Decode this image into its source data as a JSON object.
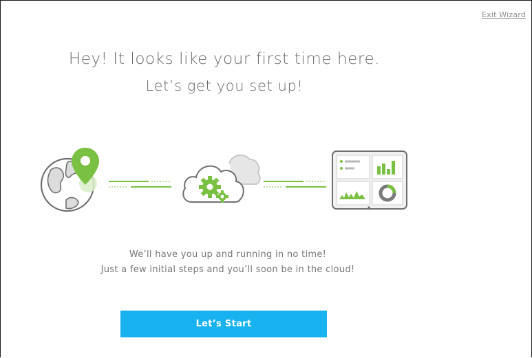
{
  "header": {
    "exit_label": "Exit Wizard"
  },
  "welcome": {
    "line1": "Hey! It looks like your first time here.",
    "line2": "Let’s get you set up!"
  },
  "illustration": {
    "icons": [
      "globe-location-icon",
      "cloud-gear-icon",
      "dashboard-icon"
    ]
  },
  "description": {
    "line1": "We’ll have you up and running in no time!",
    "line2": "Just a few initial steps and you’ll soon be in the cloud!"
  },
  "actions": {
    "start_label": "Let’s Start"
  },
  "colors": {
    "accent_green": "#7ac143",
    "button_blue": "#19b2f0",
    "text_gray": "#6b6b6b"
  }
}
